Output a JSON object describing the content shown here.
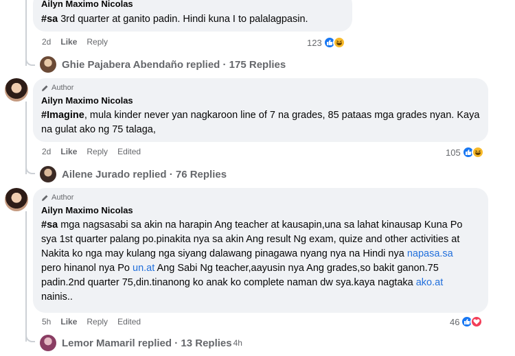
{
  "comment1": {
    "name": "Ailyn Maximo Nicolas",
    "hashtag": "#sa",
    "text": " 3rd quarter at ganito padin. Hindi kuna I to palalagpasin.",
    "time": "2d",
    "like": "Like",
    "reply": "Reply",
    "reaction_count": "123"
  },
  "reply1": {
    "text": "Ghie Pajabera Abendaño replied · 175 Replies"
  },
  "comment2": {
    "badge": "Author",
    "name": "Ailyn Maximo Nicolas",
    "hashtag": "#Imagine",
    "text": ", mula kinder never yan nagkaroon line of 7 na grades, 85 pataas mga grades nyan. Kaya na gulat ako ng 75 talaga,",
    "time": "2d",
    "like": "Like",
    "reply": "Reply",
    "edited": "Edited",
    "reaction_count": "105"
  },
  "reply2": {
    "text": "Ailene Jurado replied · 76 Replies"
  },
  "comment3": {
    "badge": "Author",
    "name": "Ailyn Maximo Nicolas",
    "hashtag": "#sa",
    "text_a": " mga nagsasabi sa akin na harapin Ang teacher at kausapin,una sa lahat kinausap Kuna Po sya 1st quarter palang po.pinakita nya sa akin Ang result Ng exam, quize and other activities at Nakita ko nga may kulang nga siyang dalawang pinagawa nyang nya na Hindi nya ",
    "link1": "napasa.sa",
    "text_b": " pero hinanol nya Po ",
    "link2": "un.at",
    "text_c": " Ang Sabi Ng teacher,aayusin nya Ang grades,so bakit ganon.75 padin.2nd quarter 75,din.tinanong ko anak ko complete naman dw sya.kaya nagtaka ",
    "link3": "ako.at",
    "text_d": " nainis..",
    "time": "5h",
    "like": "Like",
    "reply": "Reply",
    "edited": "Edited",
    "reaction_count": "46"
  },
  "reply3": {
    "text": "Lemor Mamaril replied · 13 Replies",
    "time": "4h"
  }
}
